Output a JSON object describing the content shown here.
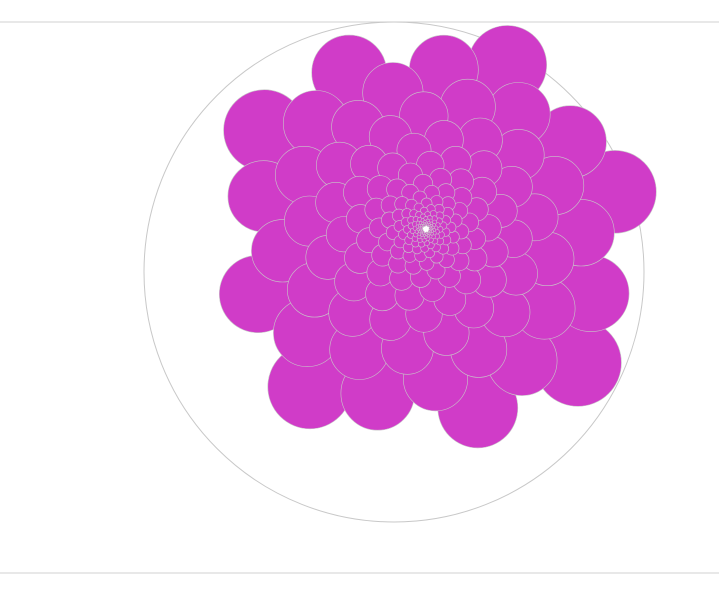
{
  "scene": {
    "description_free": true,
    "circle_fill": "#d03cc8",
    "circle_stroke": "#c8c8c8",
    "outline_stroke": "#c8c8c8",
    "rule_color": "#d0d0d0",
    "background": "#ffffff",
    "spiral": {
      "total_circles": 320,
      "divergence_angle_deg": 137.5,
      "growth": "proportional-to-distance"
    }
  }
}
